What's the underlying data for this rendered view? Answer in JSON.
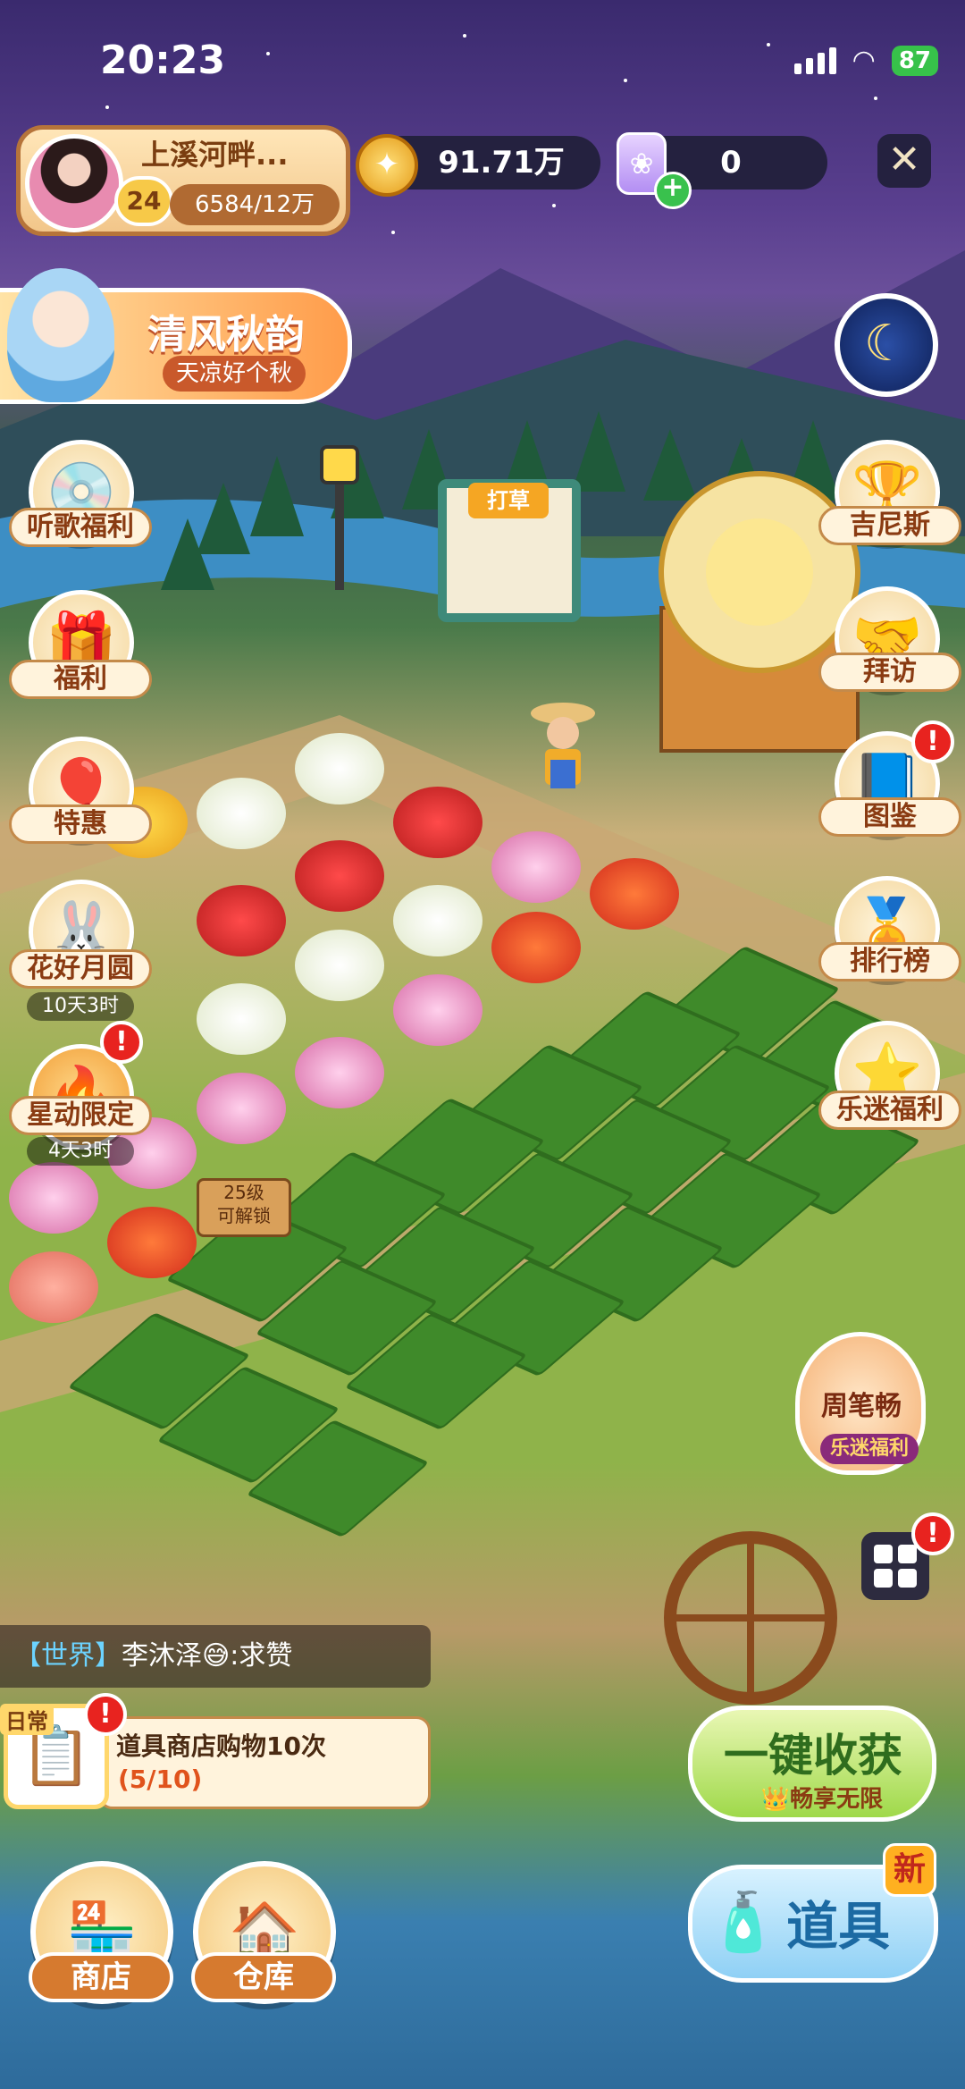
{
  "status_bar": {
    "time": "20:23",
    "battery": "87"
  },
  "profile": {
    "name": "上溪河畔...",
    "level": "24",
    "exp": "6584/12万"
  },
  "resources": {
    "coins": "91.71万",
    "gems": "0",
    "coin_symbol": "✦",
    "gem_plus": "+"
  },
  "close_symbol": "✕",
  "event_banner": {
    "title": "清风秋韵",
    "subtitle": "天凉好个秋"
  },
  "sign_title": "打草",
  "left_buttons": [
    {
      "label": "听歌福利"
    },
    {
      "label": "福利"
    },
    {
      "label": "特惠"
    },
    {
      "label": "花好月圆",
      "timer": "10天3时"
    },
    {
      "label": "星动限定",
      "timer": "4天3时",
      "alert": "!"
    }
  ],
  "right_buttons": [
    {
      "label": "吉尼斯"
    },
    {
      "label": "拜访"
    },
    {
      "label": "图鉴",
      "alert": "!"
    },
    {
      "label": "排行榜"
    },
    {
      "label": "乐迷福利"
    }
  ],
  "lock_sign": {
    "line1": "25级",
    "line2": "可解锁"
  },
  "promo": {
    "name": "周笔畅",
    "tag": "乐迷福利"
  },
  "menu_alert": "!",
  "chat": {
    "channel": "【世界】",
    "message": "李沐泽😅:求赞"
  },
  "task": {
    "tag": "日常",
    "title": "道具商店购物10次",
    "progress": "(5/10)",
    "alert": "!"
  },
  "harvest": {
    "label": "一键收获",
    "sub": "畅享无限"
  },
  "props": {
    "label": "道具",
    "badge": "新"
  },
  "bottom": {
    "shop": "商店",
    "warehouse": "仓库"
  },
  "colors": {
    "accent": "#f4c77a",
    "alert": "#e8231f",
    "grass": "#3f8a2a"
  }
}
